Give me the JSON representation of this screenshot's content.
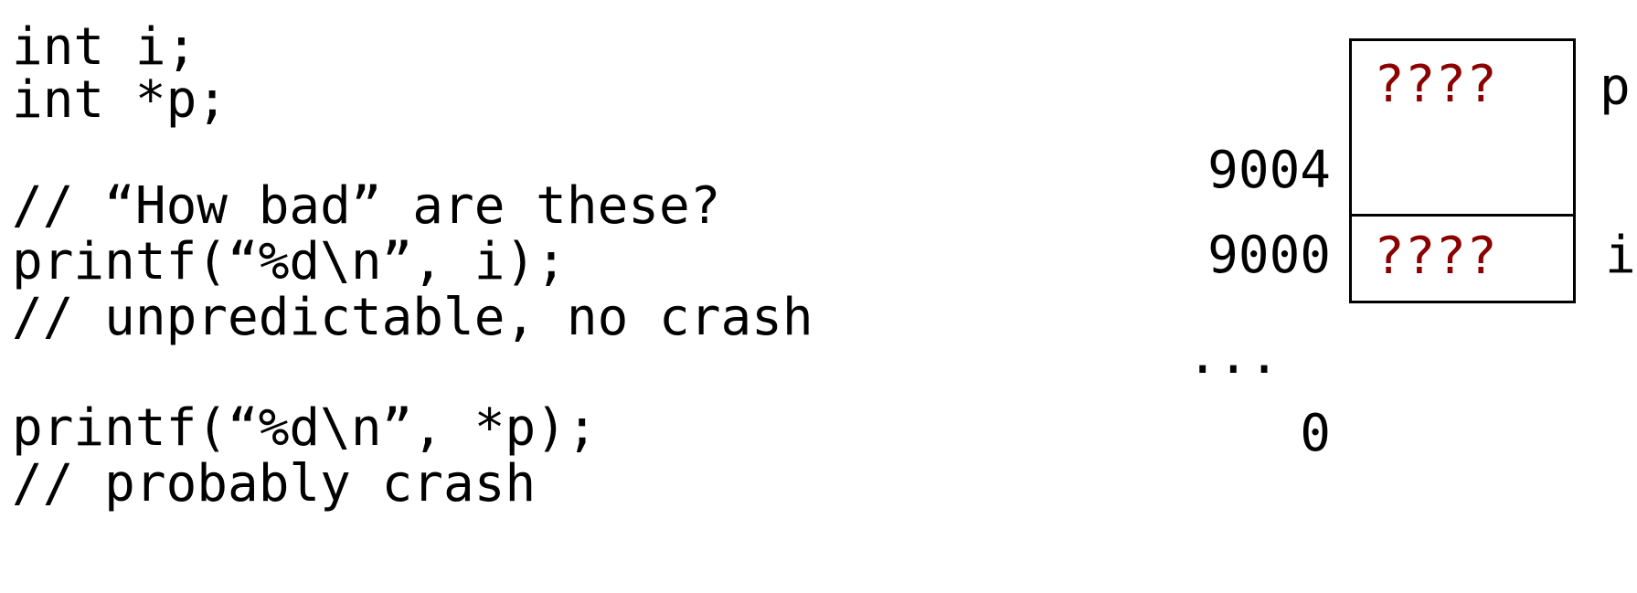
{
  "code": {
    "lines": [
      "int i;",
      "int *p;",
      "// “How bad” are these?",
      "printf(“%d\\n”, i);",
      "// unpredictable, no crash",
      "printf(“%d\\n”, *p);",
      "// probably crash"
    ]
  },
  "memory": {
    "cells": [
      {
        "value": "????",
        "variable": "p",
        "address": "9004"
      },
      {
        "value": "????",
        "variable": "i",
        "address": "9000"
      }
    ],
    "ellipsis": "...",
    "bottom_address": "0"
  },
  "colors": {
    "text": "#000000",
    "unknown_value": "#8b0000",
    "background": "#ffffff"
  }
}
